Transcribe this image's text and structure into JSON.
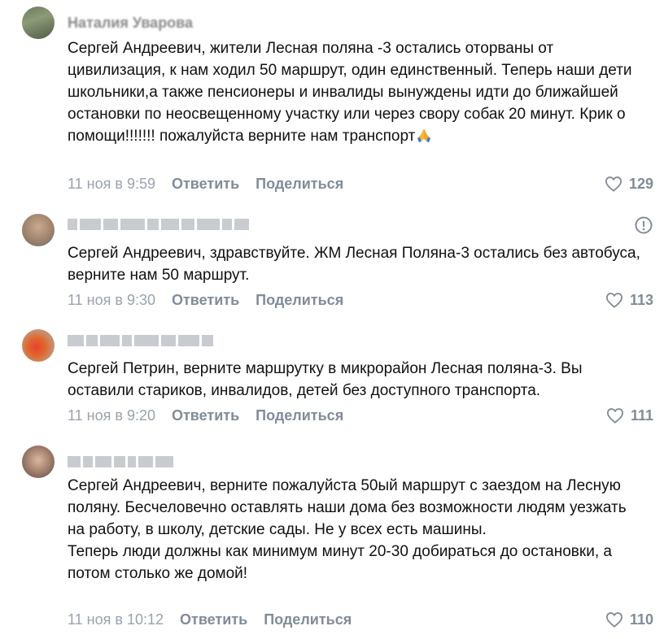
{
  "comments": [
    {
      "author": "Наталия Уварова",
      "text": [
        "Сергей Андреевич, жители Лесная поляна -3 остались оторваны от цивилизация, к нам ходил 50 маршрут, один единственный. Теперь наши дети школьники,а также пенсионеры и инвалиды вынуждены идти до ближайшей остановки по неосвещенному участку или через свору собак 20 минут. Крик о помощи!!!!!!! пожалуйста верните нам транспорт"
      ],
      "date": "11 ноя в 9:59",
      "reply": "Ответить",
      "share": "Поделиться",
      "likes": "129",
      "emoji": "folded-hands"
    },
    {
      "author": "",
      "text": [
        "Сергей Андреевич, здравствуйте. ЖМ Лесная Поляна-3 остались без автобуса, верните нам 50 маршрут."
      ],
      "date": "11 ноя в 9:30",
      "reply": "Ответить",
      "share": "Поделиться",
      "likes": "113"
    },
    {
      "author": "",
      "text": [
        "Сергей Петрин, верните маршрутку в микрорайон Лесная поляна-3. Вы оставили стариков, инвалидов, детей без доступного транспорта."
      ],
      "date": "11 ноя в 9:20",
      "reply": "Ответить",
      "share": "Поделиться",
      "likes": "111"
    },
    {
      "author": "",
      "text": [
        "Сергей Андреевич, верните пожалуйста 50ый маршрут с заездом на Лесную поляну. Бесчеловечно оставлять наши дома без возможности людям уезжать на работу, в школу, детские сады. Не у всех есть машины.",
        "Теперь люди должны как минимум минут 20-30 добираться до остановки, а потом столько же домой!"
      ],
      "date": "11 ноя в 10:12",
      "reply": "Ответить",
      "share": "Поделиться",
      "likes": "110"
    }
  ],
  "colors": {
    "meta_text": "#818c99",
    "date_text": "#99a2ad",
    "body_text": "#111111"
  }
}
